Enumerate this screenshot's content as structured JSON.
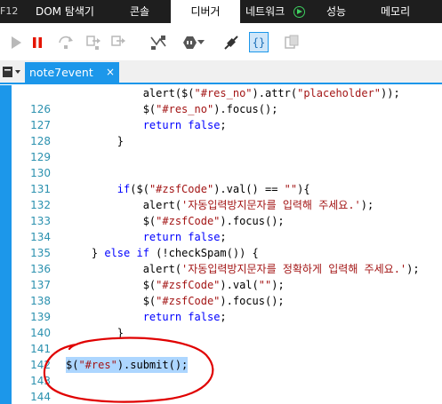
{
  "top_tabs": {
    "f12": "F12",
    "dom": "DOM 탐색기",
    "console": "콘솔",
    "debugger": "디버거",
    "network": "네트워크",
    "performance": "성능",
    "memory": "메모리"
  },
  "toolbar_icons": [
    "play-icon",
    "pause-icon",
    "step-over-icon",
    "step-into-icon",
    "step-out-icon",
    "break-on-new-worker-icon",
    "exceptions-icon",
    "disconnect-icon",
    "source-map-icon",
    "pretty-print-icon"
  ],
  "file_tab": {
    "name": "note7event",
    "close": "×"
  },
  "code": {
    "lines": [
      {
        "n": "126",
        "t": "            alert($(\"#res_no\").attr(\"placeholder\"));"
      },
      {
        "n": "127",
        "t": "            $(\"#res_no\").focus();"
      },
      {
        "n": "128",
        "t": "            return false;"
      },
      {
        "n": "129",
        "t": "        }"
      },
      {
        "n": "130",
        "t": ""
      },
      {
        "n": "131",
        "t": ""
      },
      {
        "n": "132",
        "t": "        if($(\"#zsfCode\").val() == \"\"){"
      },
      {
        "n": "133",
        "t": "            alert('자동입력방지문자를 입력해 주세요.');"
      },
      {
        "n": "134",
        "t": "            $(\"#zsfCode\").focus();"
      },
      {
        "n": "135",
        "t": "            return false;"
      },
      {
        "n": "136",
        "t": "    } else if (!checkSpam()) {"
      },
      {
        "n": "137",
        "t": "            alert('자동입력방지문자를 정확하게 입력해 주세요.');"
      },
      {
        "n": "138",
        "t": "            $(\"#zsfCode\").val(\"\");"
      },
      {
        "n": "139",
        "t": "            $(\"#zsfCode\").focus();"
      },
      {
        "n": "140",
        "t": "            return false;"
      },
      {
        "n": "141",
        "t": "        }"
      },
      {
        "n": "142",
        "t": ""
      },
      {
        "n": "143",
        "t": "$(\"#res\").submit();"
      },
      {
        "n": "144",
        "t": ""
      },
      {
        "n": "145",
        "t": ""
      }
    ]
  },
  "colors": {
    "accent": "#1c97ea",
    "line_number": "#2b91af",
    "string": "#a31515",
    "keyword": "#0000ff",
    "selection": "#add6ff",
    "annotation": "#e00000"
  }
}
